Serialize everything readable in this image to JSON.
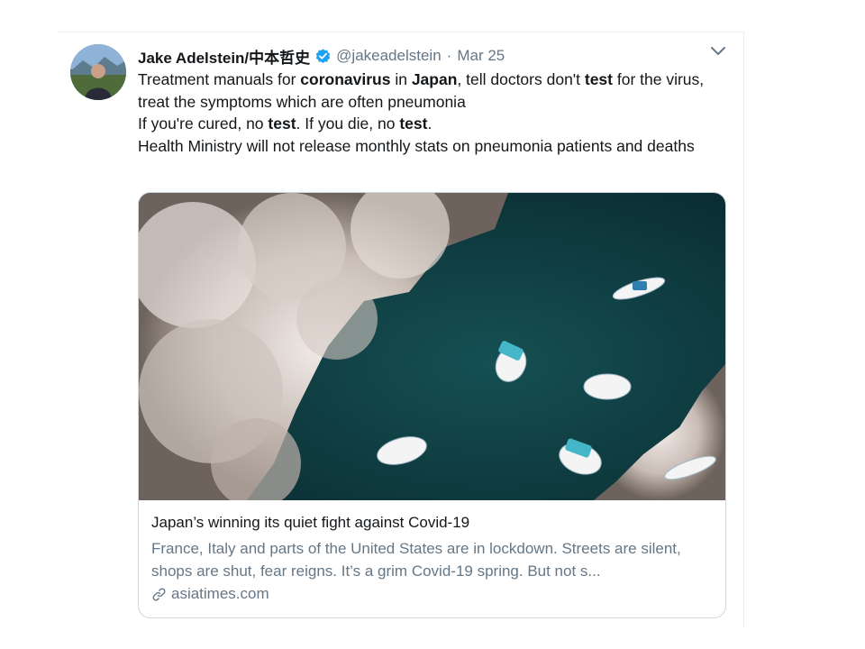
{
  "author": {
    "name": "Jake Adelstein/中本哲史",
    "handle": "@jakeadelstein",
    "separator": "·",
    "date": "Mar 25"
  },
  "tweet": {
    "line1": [
      {
        "text": "Treatment manuals for ",
        "bold": false
      },
      {
        "text": "coronavirus",
        "bold": true
      },
      {
        "text": " in ",
        "bold": false
      },
      {
        "text": "Japan",
        "bold": true
      },
      {
        "text": ", tell doctors don't ",
        "bold": false
      },
      {
        "text": "test",
        "bold": true
      },
      {
        "text": " for the virus, treat the symptoms which are often pneumonia",
        "bold": false
      }
    ],
    "line2": [
      {
        "text": "If you're cured, no ",
        "bold": false
      },
      {
        "text": "test",
        "bold": true
      },
      {
        "text": ". If you die, no ",
        "bold": false
      },
      {
        "text": "test",
        "bold": true
      },
      {
        "text": ".",
        "bold": false
      }
    ],
    "line3": "Health Ministry will not release monthly stats on pneumonia patients and deaths"
  },
  "card": {
    "title": "Japan’s winning its quiet fight against Covid-19",
    "description": "France, Italy and parts of the United States are in lockdown. Streets are silent, shops are shut, fear reigns. It’s a grim Covid-19 spring.   But not s...",
    "domain": "asiatimes.com"
  },
  "icons": {
    "verified": "verified-badge-icon",
    "more": "chevron-down-icon",
    "link": "link-icon"
  },
  "colors": {
    "text": "#14171a",
    "muted": "#657786",
    "verified": "#1da1f2",
    "border": "#ccd6dd",
    "water": "#0f3b3e"
  }
}
